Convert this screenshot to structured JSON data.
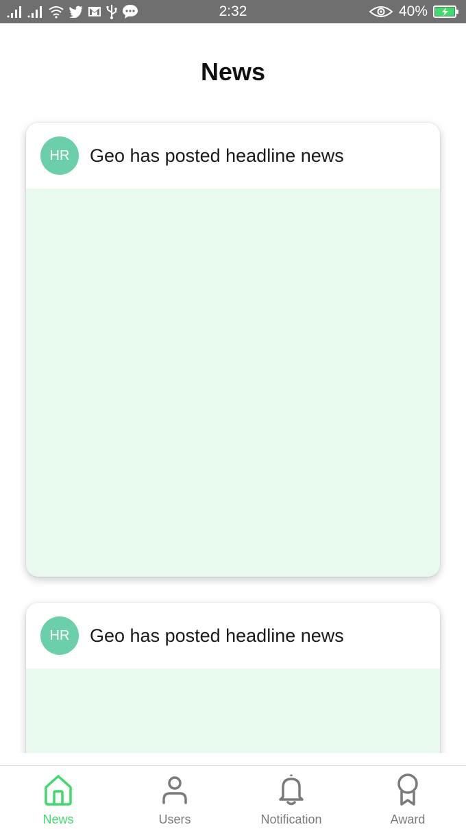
{
  "status_bar": {
    "time": "2:32",
    "battery": "40%",
    "left_icons": [
      "signal-icon",
      "signal-icon",
      "wifi-icon",
      "twitter-icon",
      "gmail-icon",
      "usb-icon",
      "message-icon"
    ],
    "right_icons": [
      "eye-icon",
      "battery-charging-icon"
    ]
  },
  "header": {
    "title": "News"
  },
  "feed": {
    "posts": [
      {
        "avatar": "HR",
        "title": "Geo has posted headline news"
      },
      {
        "avatar": "HR",
        "title": "Geo has posted headline news"
      }
    ]
  },
  "bottom_nav": {
    "items": [
      {
        "label": "News",
        "icon": "home-icon",
        "active": true
      },
      {
        "label": "Users",
        "icon": "user-icon",
        "active": false
      },
      {
        "label": "Notification",
        "icon": "bell-icon",
        "active": false
      },
      {
        "label": "Award",
        "icon": "award-icon",
        "active": false
      }
    ]
  },
  "colors": {
    "accent": "#3ddc6a",
    "avatar_bg": "#6bcfaa",
    "card_body_bg": "#e8f9ee",
    "status_bar_bg": "#6f6f6f",
    "inactive": "#7a7a7a"
  }
}
